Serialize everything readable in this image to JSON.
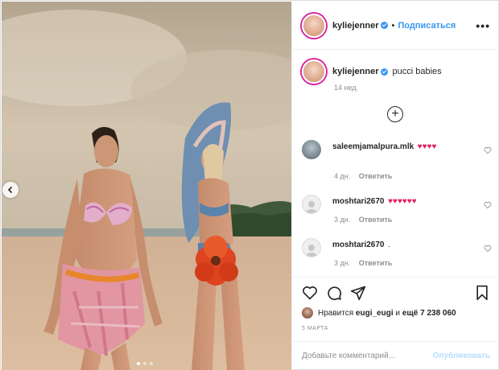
{
  "post": {
    "author": "kyliejenner",
    "separator": "•",
    "follow_label": "Подписаться",
    "more_icon": "more-horizontal-icon",
    "caption": "pucci babies",
    "time_ago": "14 нед."
  },
  "comments": [
    {
      "user": "saleemjamalpura.mlk",
      "text": "♥♥♥♥",
      "time": "4 дн.",
      "reply_label": "Ответить"
    },
    {
      "user": "moshtari2670",
      "text": "♥♥♥♥♥♥",
      "time": "3 дн.",
      "reply_label": "Ответить"
    },
    {
      "user": "moshtari2670",
      "text": ".",
      "time": "3 дн.",
      "reply_label": "Ответить"
    }
  ],
  "likes": {
    "prefix": "Нравится",
    "user": "eugi_eugi",
    "conjunction": "и",
    "others": "ещё 7 238 060"
  },
  "date": "5 МАРТА",
  "add_comment": {
    "placeholder": "Добавьте комментарий...",
    "publish_label": "Опубликовать"
  },
  "carousel": {
    "count": 3,
    "active": 0
  },
  "colors": {
    "accent": "#3897f0",
    "heart": "#ed4956",
    "text": "#262626",
    "muted": "#8e8e8e",
    "publish_disabled": "#b2dffc"
  }
}
